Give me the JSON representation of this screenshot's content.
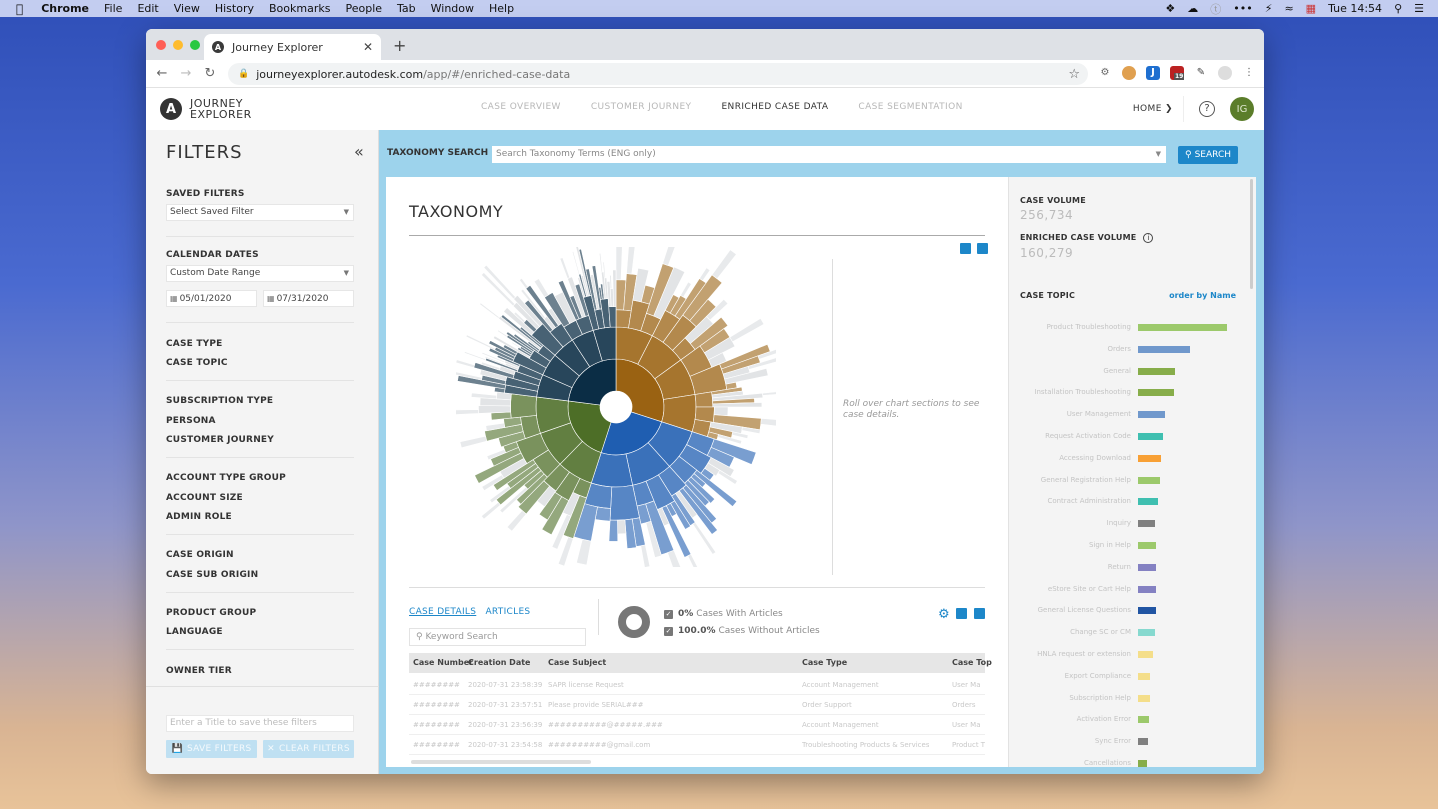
{
  "menubar": {
    "app": "Chrome",
    "items": [
      "File",
      "Edit",
      "View",
      "History",
      "Bookmarks",
      "People",
      "Tab",
      "Window",
      "Help"
    ],
    "clock": "Tue 14:54"
  },
  "browser": {
    "tab_title": "Journey Explorer",
    "url_host": "journeyexplorer.autodesk.com",
    "url_path": "/app/#/enriched-case-data",
    "extension_badge": "19"
  },
  "header": {
    "logo_line1": "JOURNEY",
    "logo_line2": "EXPLORER",
    "nav": [
      {
        "label": "CASE OVERVIEW",
        "active": false
      },
      {
        "label": "CUSTOMER JOURNEY",
        "active": false
      },
      {
        "label": "ENRICHED CASE DATA",
        "active": true
      },
      {
        "label": "CASE SEGMENTATION",
        "active": false
      }
    ],
    "home_label": "HOME",
    "help_label": "?",
    "avatar_initials": "IG"
  },
  "filters": {
    "title": "FILTERS",
    "saved_filters_label": "SAVED FILTERS",
    "saved_filters_value": "Select Saved Filter",
    "calendar_label": "CALENDAR DATES",
    "calendar_value": "Custom Date Range",
    "date_from": "05/01/2020",
    "date_to": "07/31/2020",
    "groups": [
      [
        "CASE TYPE",
        "CASE TOPIC"
      ],
      [
        "SUBSCRIPTION TYPE",
        "PERSONA",
        "CUSTOMER JOURNEY"
      ],
      [
        "ACCOUNT TYPE GROUP",
        "ACCOUNT SIZE",
        "ADMIN ROLE"
      ],
      [
        "CASE ORIGIN",
        "CASE SUB ORIGIN"
      ],
      [
        "PRODUCT GROUP",
        "LANGUAGE"
      ],
      [
        "OWNER TIER"
      ]
    ],
    "title_placeholder": "Enter a Title to save these filters",
    "save_label": "SAVE FILTERS",
    "clear_label": "CLEAR FILTERS"
  },
  "taxonomy_search": {
    "label": "TAXONOMY SEARCH",
    "placeholder": "Search Taxonomy Terms (ENG only)",
    "button": "SEARCH"
  },
  "taxonomy": {
    "title": "TAXONOMY",
    "rollover_hint": "Roll over chart sections to see case details."
  },
  "details": {
    "tabs": [
      {
        "label": "CASE DETAILS",
        "active": true
      },
      {
        "label": "ARTICLES",
        "active": false
      }
    ],
    "keyword_placeholder": "Keyword Search",
    "with_articles_pct": "0%",
    "with_articles_label": "Cases With Articles",
    "without_articles_pct": "100.0%",
    "without_articles_label": "Cases Without Articles",
    "columns": [
      "Case Number",
      "Creation Date",
      "Case Subject",
      "Case Type",
      "Case Top"
    ],
    "rows": [
      [
        "########",
        "2020-07-31 23:58:39",
        "SAPR license Request",
        "Account Management",
        "User Ma"
      ],
      [
        "########",
        "2020-07-31 23:57:51",
        "Please provide SERIAL###",
        "Order Support",
        "Orders"
      ],
      [
        "########",
        "2020-07-31 23:56:39",
        "##########@#####.###",
        "Account Management",
        "User Ma"
      ],
      [
        "########",
        "2020-07-31 23:54:58",
        "##########@gmail.com",
        "Troubleshooting Products & Services",
        "Product T"
      ]
    ]
  },
  "summary": {
    "case_volume_label": "CASE VOLUME",
    "case_volume": "256,734",
    "enriched_label": "ENRICHED CASE VOLUME",
    "enriched_volume": "160,279",
    "topic_label": "CASE TOPIC",
    "order_by": "order by Name"
  },
  "chart_data": [
    {
      "type": "bar",
      "title": "CASE TOPIC",
      "orientation": "horizontal",
      "note": "relative values estimated from bar lengths (max = 100)",
      "categories": [
        "Product Troubleshooting",
        "Orders",
        "General",
        "Installation Troubleshooting",
        "User Management",
        "Request Activation Code",
        "Accessing Download",
        "General Registration Help",
        "Contract Administration",
        "Inquiry",
        "Sign in Help",
        "Return",
        "eStore Site or Cart Help",
        "General License Questions",
        "Change SC or CM",
        "HNLA request or extension",
        "Export Compliance",
        "Subscription Help",
        "Activation Error",
        "Sync Error",
        "Cancellations"
      ],
      "values": [
        100,
        58,
        42,
        40,
        30,
        28,
        26,
        25,
        22,
        19,
        20,
        20,
        20,
        20,
        19,
        17,
        14,
        13,
        12,
        11,
        10
      ],
      "colors": [
        "#9cc96b",
        "#7098cc",
        "#87ad4a",
        "#87ad4a",
        "#7098cc",
        "#3fbfb0",
        "#f8a035",
        "#9cc96b",
        "#3fbfb0",
        "#808080",
        "#9cc96b",
        "#8481c2",
        "#8481c2",
        "#2155a3",
        "#86d9cf",
        "#f4de8a",
        "#f4de8a",
        "#f4de8a",
        "#9cc96b",
        "#808080",
        "#87ad4a"
      ]
    },
    {
      "type": "sunburst",
      "title": "TAXONOMY",
      "root_segments": [
        {
          "name": "segment-1",
          "color": "#9a6212",
          "share": 0.3
        },
        {
          "name": "segment-2",
          "color": "#1f5eb1",
          "share": 0.25
        },
        {
          "name": "segment-3",
          "color": "#4d6e27",
          "share": 0.22
        },
        {
          "name": "segment-4",
          "color": "#0b2d45",
          "share": 0.23
        }
      ]
    }
  ]
}
